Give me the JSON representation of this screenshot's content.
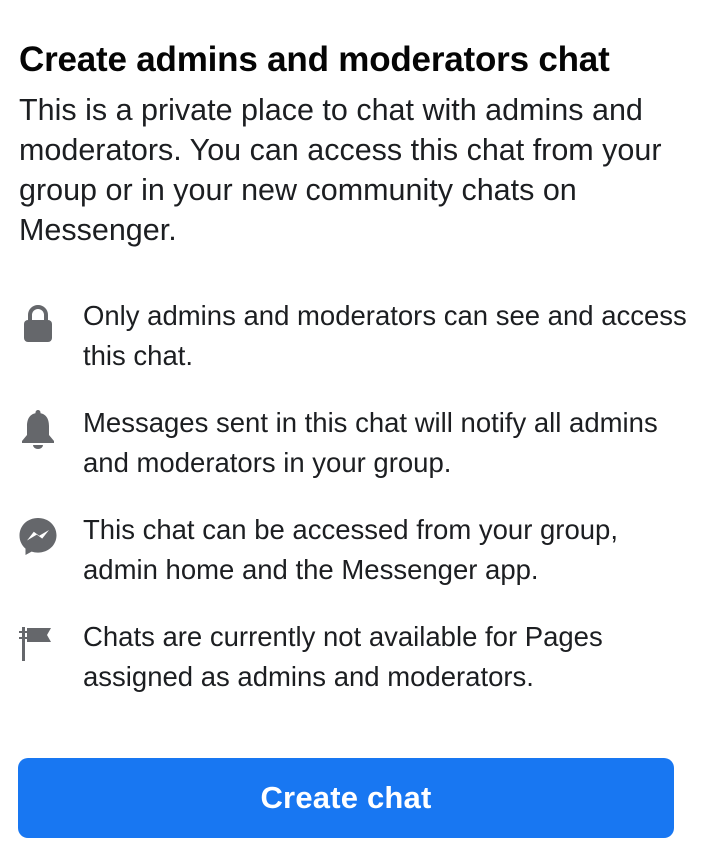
{
  "header": {
    "title": "Create admins and moderators chat",
    "description": "This is a private place to chat with admins and moderators. You can access this chat from your group or in your new community chats on Messenger."
  },
  "features": [
    {
      "icon": "lock-icon",
      "text": "Only admins and moderators can see and access this chat."
    },
    {
      "icon": "bell-icon",
      "text": "Messages sent in this chat will notify all admins and moderators in your group."
    },
    {
      "icon": "messenger-icon",
      "text": "This chat can be accessed from your group, admin home and the Messenger app."
    },
    {
      "icon": "flag-icon",
      "text": "Chats are currently not available for Pages assigned as admins and moderators."
    }
  ],
  "actions": {
    "create_label": "Create chat"
  },
  "colors": {
    "primary": "#1877f2",
    "icon": "#65676b",
    "text": "#1c1e21"
  }
}
